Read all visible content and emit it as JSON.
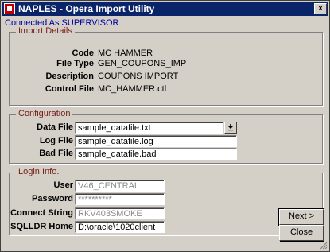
{
  "window": {
    "title": "NAPLES - Opera Import Utility",
    "close_label": "x"
  },
  "status": {
    "text": "Connected As SUPERVISOR"
  },
  "import_details": {
    "legend": "Import Details",
    "code_label": "Code",
    "code_value": "MC HAMMER",
    "file_type_label": "File Type",
    "file_type_value": "GEN_COUPONS_IMP",
    "description_label": "Description",
    "description_value": "COUPONS IMPORT",
    "control_file_label": "Control File",
    "control_file_value": "MC_HAMMER.ctl"
  },
  "configuration": {
    "legend": "Configuration",
    "data_file_label": "Data File",
    "data_file_value": "sample_datafile.txt",
    "log_file_label": "Log File",
    "log_file_value": "sample_datafile.log",
    "bad_file_label": "Bad File",
    "bad_file_value": "sample_datafile.bad"
  },
  "login": {
    "legend": "Login Info.",
    "user_label": "User",
    "user_value": "V46_CENTRAL",
    "password_label": "Password",
    "password_value": "**********",
    "connect_label": "Connect String",
    "connect_value": "RKV403SMOKE",
    "sqlldr_label": "SQLLDR Home",
    "sqlldr_value": "D:\\oracle\\1020client"
  },
  "buttons": {
    "next": "Next >",
    "close": "Close"
  },
  "icons": {
    "app": "oracle-app-icon",
    "dropdown": "download-arrow-icon"
  }
}
